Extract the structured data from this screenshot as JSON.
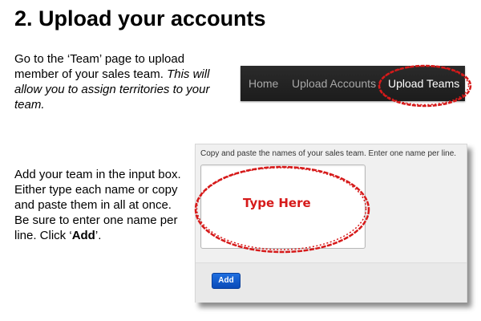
{
  "heading": "2. Upload your accounts",
  "intro": {
    "text_before": "Go to the ‘Team’ page to upload member of your sales team. ",
    "text_italic": "This will allow you to assign territories to your team."
  },
  "nav": {
    "items": [
      "Home",
      "Upload Accounts",
      "Upload Teams"
    ],
    "active_index": 2
  },
  "step": {
    "text_before": "Add your team in the input box. Either type each name or copy and paste them in all at once. Be sure to enter one name per line. Click ‘",
    "text_bold": "Add",
    "text_after": "’."
  },
  "form": {
    "instruction": "Copy and paste the names of your sales team. Enter one name per line.",
    "textarea_value": "",
    "add_label": "Add"
  },
  "annotation": {
    "label": "Type Here",
    "color": "#d61a1a"
  },
  "colors": {
    "navbar_bg": "#222222",
    "nav_active": "#ffffff",
    "nav_inactive": "#a8a8a8",
    "button_blue": "#0d55c9"
  }
}
